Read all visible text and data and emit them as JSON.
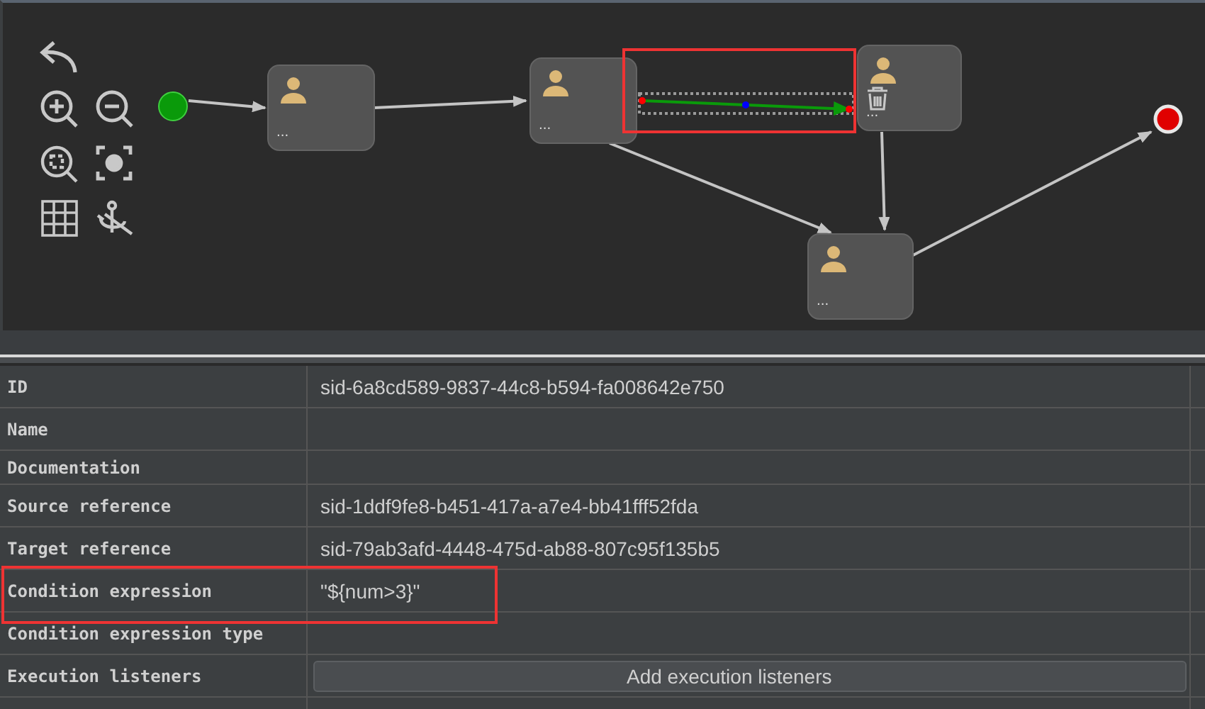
{
  "diagram": {
    "nodes": [
      {
        "kind": "start"
      },
      {
        "kind": "user-task",
        "label": "..."
      },
      {
        "kind": "user-task",
        "label": "..."
      },
      {
        "kind": "user-task",
        "label": "..."
      },
      {
        "kind": "user-task",
        "label": "..."
      },
      {
        "kind": "end"
      }
    ],
    "edges": [
      {
        "selected": false
      },
      {
        "selected": false
      },
      {
        "selected": true
      },
      {
        "selected": false
      },
      {
        "selected": false
      },
      {
        "selected": false
      }
    ]
  },
  "properties": [
    {
      "kind": "text",
      "label": "ID",
      "value": "sid-6a8cd589-9837-44c8-b594-fa008642e750"
    },
    {
      "kind": "text",
      "label": "Name"
    },
    {
      "kind": "text",
      "label": "Documentation"
    },
    {
      "kind": "text",
      "label": "Source reference",
      "value": "sid-1ddf9fe8-b451-417a-a7e4-bb41fff52fda"
    },
    {
      "kind": "text",
      "label": "Target reference",
      "value": "sid-79ab3afd-4448-475d-ab88-807c95f135b5"
    },
    {
      "kind": "text",
      "label": "Condition expression",
      "value": "\"${num>3}\""
    },
    {
      "kind": "text",
      "label": "Condition expression type"
    },
    {
      "kind": "button",
      "label": "Execution listeners",
      "value": "Add execution listeners"
    }
  ]
}
